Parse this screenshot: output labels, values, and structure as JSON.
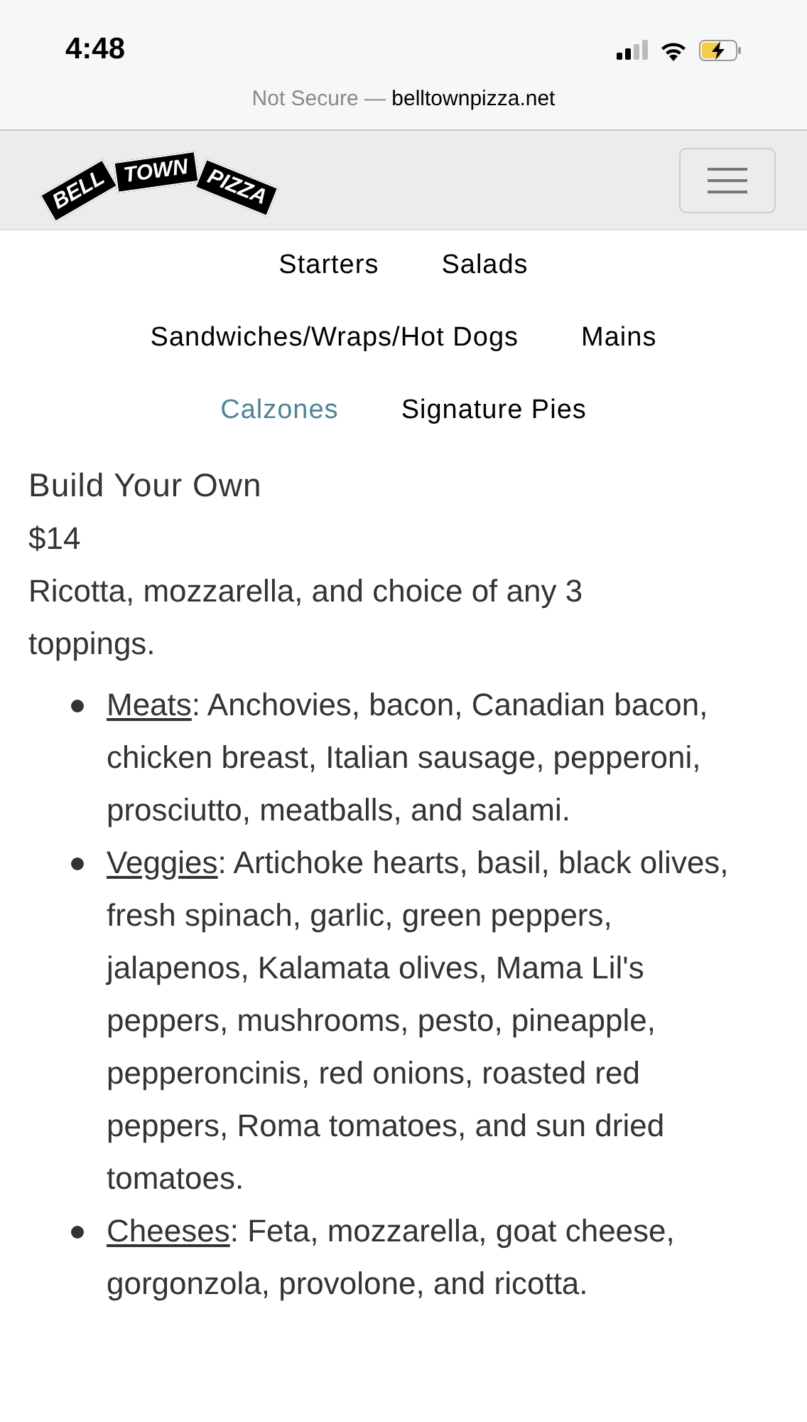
{
  "status_bar": {
    "time": "4:48"
  },
  "address_bar": {
    "security": "Not Secure —",
    "domain": "belltownpizza.net"
  },
  "logo": {
    "words": [
      "BELL",
      "TOWN",
      "PIZZA"
    ]
  },
  "nav_rows": [
    [
      {
        "label": "Starters",
        "selected": false
      },
      {
        "label": "Salads",
        "selected": false
      }
    ],
    [
      {
        "label": "Sandwiches/Wraps/Hot Dogs",
        "selected": false
      },
      {
        "label": "Mains",
        "selected": false
      }
    ],
    [
      {
        "label": "Calzones",
        "selected": true
      },
      {
        "label": "Signature Pies",
        "selected": false
      }
    ]
  ],
  "item": {
    "title": "Build Your Own",
    "price": "$14",
    "description": "Ricotta, mozzarella, and choice of any 3 toppings."
  },
  "options": [
    {
      "label": "Meats",
      "text": ": Anchovies, bacon, Canadian bacon, chicken breast, Italian sausage, pepperoni, prosciutto, meatballs, and salami."
    },
    {
      "label": "Veggies",
      "text": ": Artichoke hearts, basil, black olives, fresh spinach, garlic, green peppers, jalapenos, Kalamata olives, Mama Lil's peppers, mushrooms, pesto, pineapple, pepperoncinis, red onions, roasted red peppers, Roma tomatoes, and sun dried tomatoes."
    },
    {
      "label": "Cheeses",
      "text": ": Feta, mozzarella, goat cheese, gorgonzola, provolone, and ricotta."
    }
  ]
}
